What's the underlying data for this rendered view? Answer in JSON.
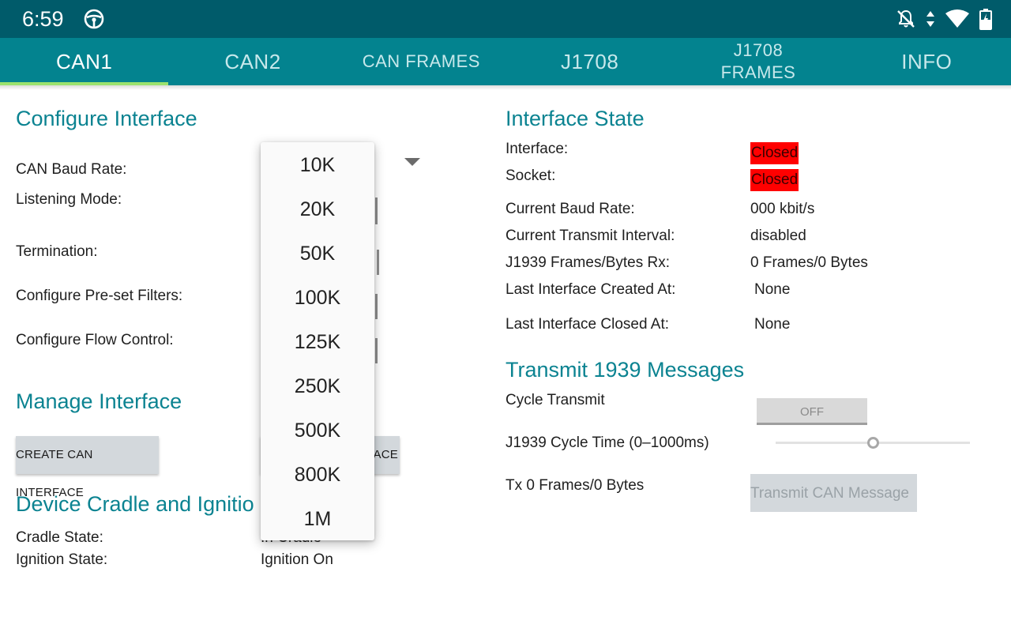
{
  "status_bar": {
    "time": "6:59",
    "icons": [
      "steering-wheel-icon",
      "notifications-off-icon",
      "data-arrows-icon",
      "wifi-icon",
      "battery-charging-icon"
    ]
  },
  "tabs": [
    {
      "label": "CAN1",
      "active": true
    },
    {
      "label": "CAN2",
      "active": false
    },
    {
      "label": "CAN FRAMES",
      "active": false
    },
    {
      "label": "J1708",
      "active": false
    },
    {
      "label": "J1708\nFRAMES",
      "active": false
    },
    {
      "label": "INFO",
      "active": false
    }
  ],
  "configure": {
    "title": "Configure Interface",
    "baud_label": "CAN Baud Rate:",
    "listening_label": "Listening Mode:",
    "termination_label": "Termination:",
    "filters_label": "Configure Pre-set Filters:",
    "flow_label": "Configure Flow Control:"
  },
  "manage": {
    "title": "Manage Interface",
    "create_button": "CREATE CAN INTERFACE",
    "close_button_visible": "ACE"
  },
  "cradle": {
    "title": "Device Cradle and Ignitio",
    "cradle_label": "Cradle State:",
    "cradle_value": "In Cradle",
    "ignition_label": "Ignition State:",
    "ignition_value": "Ignition On"
  },
  "interface_state": {
    "title": "Interface State",
    "interface_label": "Interface:",
    "interface_value": "Closed",
    "socket_label": "Socket:",
    "socket_value": "Closed",
    "baud_label": "Current Baud Rate:",
    "baud_value": "000 kbit/s",
    "tx_interval_label": "Current Transmit Interval:",
    "tx_interval_value": "disabled",
    "rx_label": "J1939 Frames/Bytes Rx:",
    "rx_value": "0 Frames/0 Bytes",
    "created_label": "Last Interface Created At:",
    "created_value": "None",
    "closed_label": "Last Interface Closed At:",
    "closed_value": "None",
    "closed_color": "#ff0000"
  },
  "transmit": {
    "title": "Transmit 1939 Messages",
    "cycle_label": "Cycle Transmit",
    "toggle_text": "OFF",
    "cycle_time_label": "J1939 Cycle Time (0–1000ms)",
    "slider_value_fraction": 0.5,
    "tx_status": "Tx 0 Frames/0 Bytes",
    "transmit_button": "Transmit CAN Message"
  },
  "baud_dropdown": {
    "options": [
      "10K",
      "20K",
      "50K",
      "100K",
      "125K",
      "250K",
      "500K",
      "800K",
      "1M"
    ]
  },
  "colors": {
    "status_bar": "#005b6a",
    "tab_bar": "#03838f",
    "tab_indicator": "#9be26e",
    "section_title": "#0b8391"
  }
}
